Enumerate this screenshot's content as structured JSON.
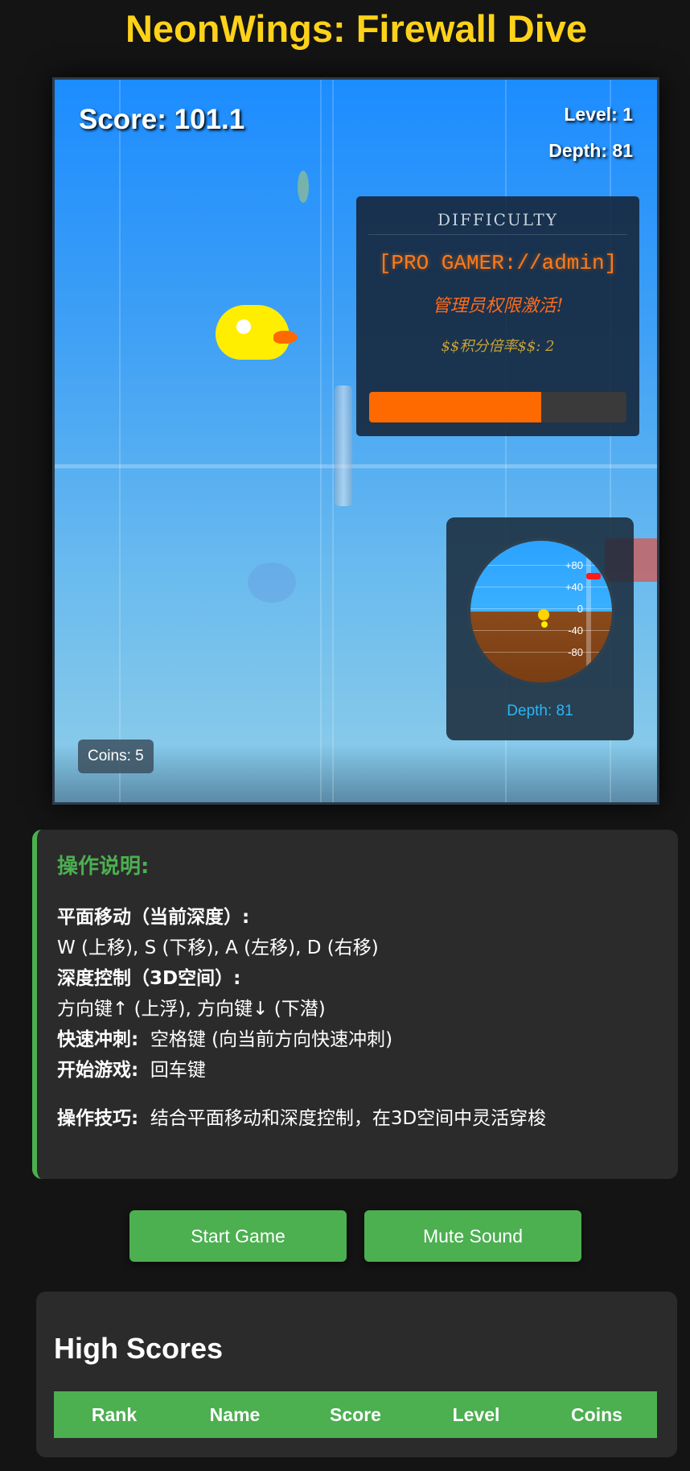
{
  "title": "NeonWings: Firewall Dive",
  "hud": {
    "score": "Score: 101.1",
    "level": "Level: 1",
    "depth": "Depth: 81",
    "coins": "Coins: 5"
  },
  "difficulty": {
    "heading": "DIFFICULTY",
    "mode": "[PRO GAMER://admin]",
    "message": "管理员权限激活!",
    "rate": "$$积分倍率$$: 2",
    "progress": 0.67,
    "progress_color": "#ff6a00"
  },
  "depth_gauge": {
    "labels": [
      "+80",
      "+40",
      "0",
      "-40",
      "-80"
    ],
    "readout": "Depth: 81"
  },
  "instructions": {
    "title": "操作说明:",
    "planar_label": "平面移动（当前深度）:",
    "planar_keys": "W (上移), S (下移), A (左移), D (右移)",
    "depth_label": "深度控制（3D空间）:",
    "depth_keys": "方向键↑ (上浮), 方向键↓ (下潜)",
    "dash_label": "快速冲刺:",
    "dash_keys": "空格键 (向当前方向快速冲刺)",
    "start_label": "开始游戏:",
    "start_keys": "回车键",
    "tip_label": "操作技巧:",
    "tip_text": "结合平面移动和深度控制，在3D空间中灵活穿梭"
  },
  "buttons": {
    "start": "Start Game",
    "mute": "Mute Sound"
  },
  "high_scores": {
    "title": "High Scores",
    "columns": [
      "Rank",
      "Name",
      "Score",
      "Level",
      "Coins"
    ]
  },
  "colors": {
    "title": "#ffd21a",
    "accent": "#4caf50",
    "sky": "#1c8cff"
  }
}
